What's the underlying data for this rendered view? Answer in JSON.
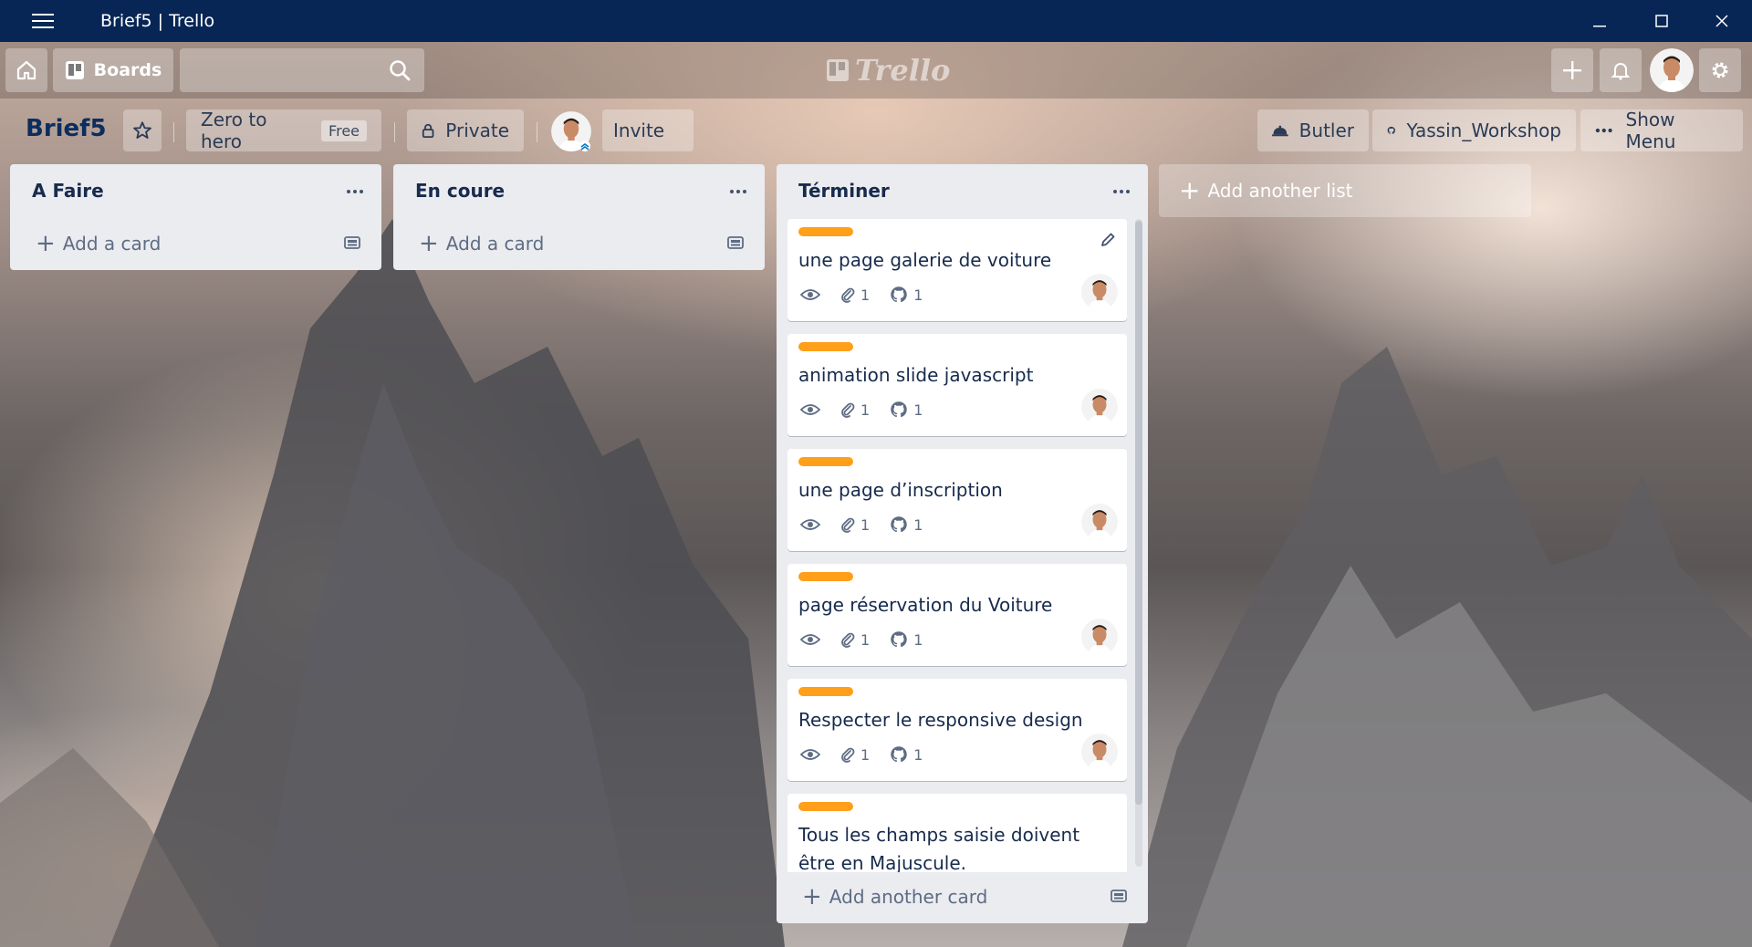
{
  "window": {
    "title": "Brief5 | Trello"
  },
  "header": {
    "boards_label": "Boards",
    "search_placeholder": "",
    "logo_text": "Trello"
  },
  "board": {
    "title": "Brief5",
    "team_name": "Zero to hero",
    "team_plan": "Free",
    "visibility": "Private",
    "invite_label": "Invite",
    "butler_label": "Butler",
    "powerup_label": "Yassin_Workshop",
    "show_menu_label": "Show Menu"
  },
  "lists": [
    {
      "title": "A Faire",
      "add_card_label": "Add a card",
      "cards": []
    },
    {
      "title": "En coure",
      "add_card_label": "Add a card",
      "cards": []
    },
    {
      "title": "Términer",
      "add_card_label": "Add another card",
      "cards": [
        {
          "title": "une page galerie de voiture",
          "attachments": "1",
          "github": "1",
          "label_color": "#ff9f1a"
        },
        {
          "title": "animation slide javascript",
          "attachments": "1",
          "github": "1",
          "label_color": "#ff9f1a"
        },
        {
          "title": "une page d’inscription",
          "attachments": "1",
          "github": "1",
          "label_color": "#ff9f1a"
        },
        {
          "title": "page réservation du Voiture",
          "attachments": "1",
          "github": "1",
          "label_color": "#ff9f1a"
        },
        {
          "title": "Respecter le responsive design",
          "attachments": "1",
          "github": "1",
          "label_color": "#ff9f1a"
        },
        {
          "title": "Tous les champs saisie doivent être en Majuscule.",
          "attachments": "",
          "github": "",
          "label_color": "#ff9f1a"
        }
      ]
    }
  ],
  "add_list_label": "Add another list",
  "colors": {
    "titlebar": "#072655",
    "label_orange": "#ff9f1a",
    "list_bg": "#ebecf0",
    "board_title": "#0c2d5e"
  }
}
